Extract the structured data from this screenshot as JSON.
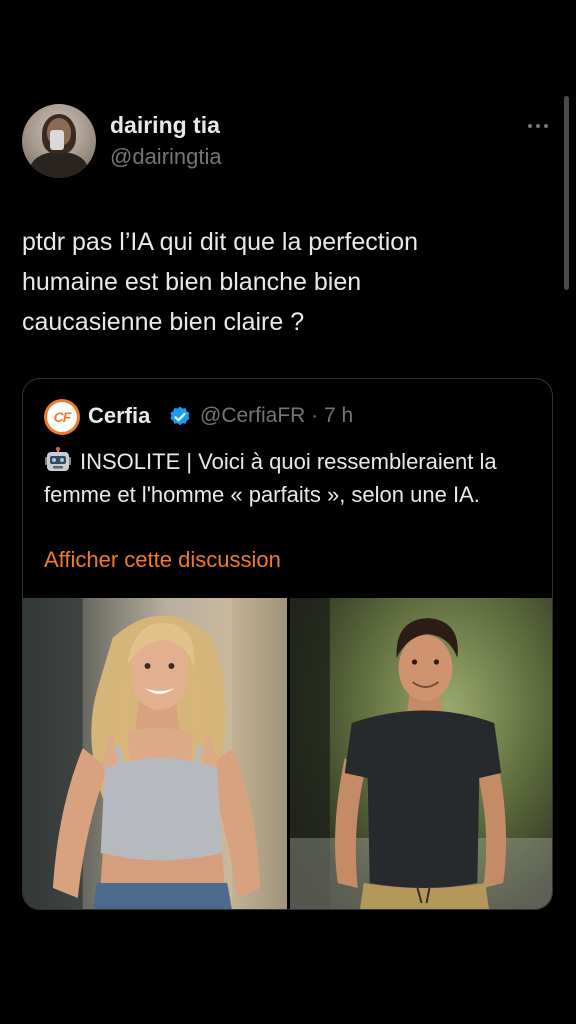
{
  "tweet": {
    "author_name": "dairing tia",
    "author_handle": "@dairingtia",
    "text": "ptdr pas l’IA qui dit que la perfection\nhumaine est bien blanche bien\ncaucasienne bien claire ?"
  },
  "quote": {
    "logo_text": "CF",
    "author_name": "Cerfia",
    "author_handle": "@CerfiaFR · 7 h",
    "text": "INSOLITE | Voici à quoi ressembleraient la femme et l'homme « parfaits », selon une IA.",
    "thread_link": "Afficher cette discussion"
  },
  "colors": {
    "background": "#000000",
    "text": "#e7e9ea",
    "muted": "#71767b",
    "accent": "#f07a2a",
    "verified": "#1d9bf0",
    "border": "#2f3336"
  },
  "icons": {
    "more": "ellipsis-icon",
    "verified": "verified-badge-icon",
    "robot": "robot-emoji-icon"
  }
}
